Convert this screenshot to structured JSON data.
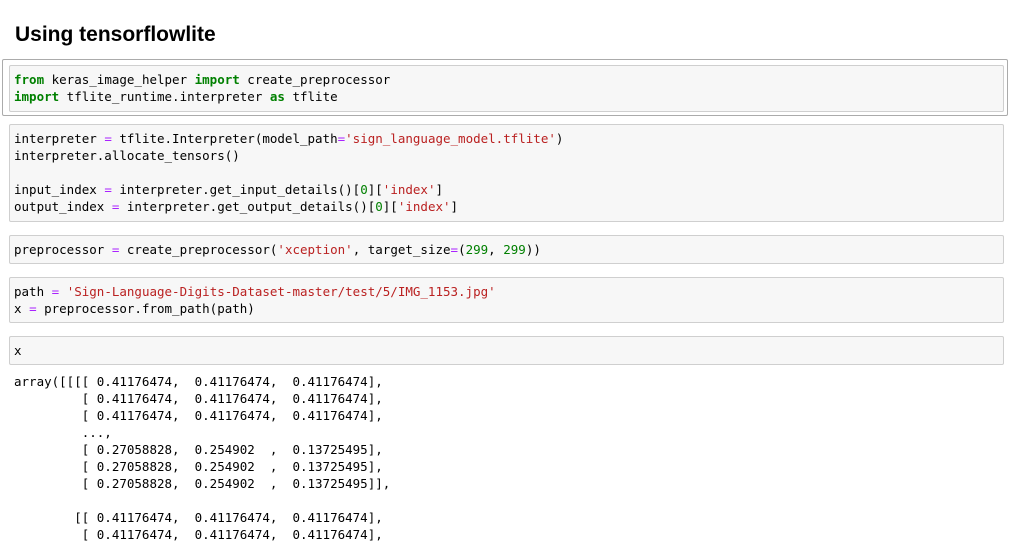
{
  "heading": "Using tensorflowlite",
  "cells": [
    {
      "lines": [
        [
          {
            "t": "from",
            "c": "kw"
          },
          {
            "t": " keras_image_helper "
          },
          {
            "t": "import",
            "c": "kw"
          },
          {
            "t": " create_preprocessor"
          }
        ],
        [
          {
            "t": "import",
            "c": "kw"
          },
          {
            "t": " tflite_runtime.interpreter "
          },
          {
            "t": "as",
            "c": "kw"
          },
          {
            "t": " tflite"
          }
        ]
      ]
    },
    {
      "lines": [
        [
          {
            "t": "interpreter "
          },
          {
            "t": "=",
            "c": "op"
          },
          {
            "t": " tflite.Interpreter(model_path"
          },
          {
            "t": "=",
            "c": "op"
          },
          {
            "t": "'sign_language_model.tflite'",
            "c": "st"
          },
          {
            "t": ")"
          }
        ],
        [
          {
            "t": "interpreter.allocate_tensors()"
          }
        ],
        [],
        [
          {
            "t": "input_index "
          },
          {
            "t": "=",
            "c": "op"
          },
          {
            "t": " interpreter.get_input_details()["
          },
          {
            "t": "0",
            "c": "nm"
          },
          {
            "t": "]["
          },
          {
            "t": "'index'",
            "c": "st"
          },
          {
            "t": "]"
          }
        ],
        [
          {
            "t": "output_index "
          },
          {
            "t": "=",
            "c": "op"
          },
          {
            "t": " interpreter.get_output_details()["
          },
          {
            "t": "0",
            "c": "nm"
          },
          {
            "t": "]["
          },
          {
            "t": "'index'",
            "c": "st"
          },
          {
            "t": "]"
          }
        ]
      ]
    },
    {
      "lines": [
        [
          {
            "t": "preprocessor "
          },
          {
            "t": "=",
            "c": "op"
          },
          {
            "t": " create_preprocessor("
          },
          {
            "t": "'xception'",
            "c": "st"
          },
          {
            "t": ", target_size"
          },
          {
            "t": "=",
            "c": "op"
          },
          {
            "t": "("
          },
          {
            "t": "299",
            "c": "nm"
          },
          {
            "t": ", "
          },
          {
            "t": "299",
            "c": "nm"
          },
          {
            "t": "))"
          }
        ]
      ]
    },
    {
      "lines": [
        [
          {
            "t": "path "
          },
          {
            "t": "=",
            "c": "op"
          },
          {
            "t": " "
          },
          {
            "t": "'Sign-Language-Digits-Dataset-master/test/5/IMG_1153.jpg'",
            "c": "st"
          }
        ],
        [
          {
            "t": "x "
          },
          {
            "t": "=",
            "c": "op"
          },
          {
            "t": " preprocessor.from_path(path)"
          }
        ]
      ]
    },
    {
      "lines": [
        [
          {
            "t": "x"
          }
        ]
      ]
    }
  ],
  "output_lines": [
    "array([[[[ 0.41176474,  0.41176474,  0.41176474],",
    "         [ 0.41176474,  0.41176474,  0.41176474],",
    "         [ 0.41176474,  0.41176474,  0.41176474],",
    "         ...,",
    "         [ 0.27058828,  0.254902  ,  0.13725495],",
    "         [ 0.27058828,  0.254902  ,  0.13725495],",
    "         [ 0.27058828,  0.254902  ,  0.13725495]],",
    "",
    "        [[ 0.41176474,  0.41176474,  0.41176474],",
    "         [ 0.41176474,  0.41176474,  0.41176474],"
  ]
}
